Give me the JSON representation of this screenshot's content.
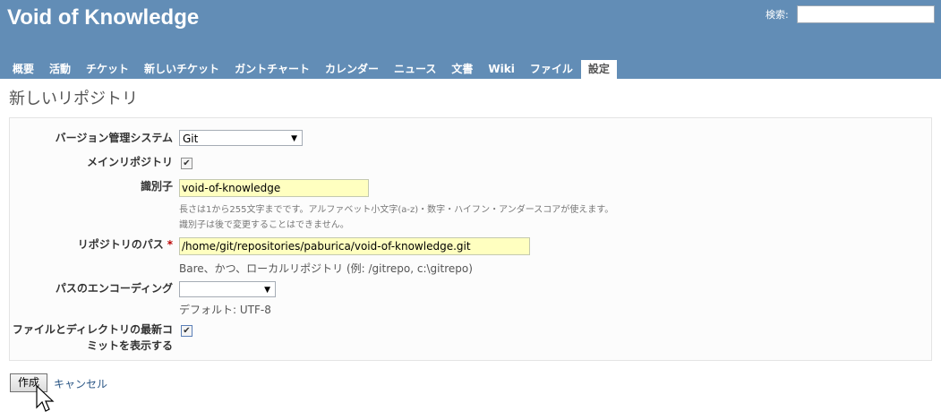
{
  "header": {
    "site_title": "Void of Knowledge",
    "search_label": "検索:",
    "search_value": ""
  },
  "tabs": [
    {
      "label": "概要"
    },
    {
      "label": "活動"
    },
    {
      "label": "チケット"
    },
    {
      "label": "新しいチケット"
    },
    {
      "label": "ガントチャート"
    },
    {
      "label": "カレンダー"
    },
    {
      "label": "ニュース"
    },
    {
      "label": "文書"
    },
    {
      "label": "Wiki"
    },
    {
      "label": "ファイル"
    },
    {
      "label": "設定",
      "selected": true
    }
  ],
  "page_title": "新しいリポジトリ",
  "form": {
    "scm": {
      "label": "バージョン管理システム",
      "value": "Git"
    },
    "main_repo": {
      "label": "メインリポジトリ",
      "checked": true
    },
    "identifier": {
      "label": "識別子",
      "value": "void-of-knowledge",
      "hint1": "長さは1から255文字までです。アルファベット小文字(a-z)・数字・ハイフン・アンダースコアが使えます。",
      "hint2": "識別子は後で変更することはできません。"
    },
    "repo_path": {
      "label": "リポジトリのパス",
      "required_mark": "*",
      "value": "/home/git/repositories/paburica/void-of-knowledge.git",
      "hint": "Bare、かつ、ローカルリポジトリ (例: /gitrepo, c:\\gitrepo)"
    },
    "path_encoding": {
      "label": "パスのエンコーディング",
      "value": "",
      "hint": "デフォルト: UTF-8"
    },
    "report_last_commit": {
      "label_line1": "ファイルとディレクトリの最新コ",
      "label_line2": "ミットを表示する",
      "checked": true
    }
  },
  "actions": {
    "create_label": "作成",
    "cancel_label": "キャンセル"
  },
  "icons": {
    "dropdown": "▼",
    "check": "✔"
  }
}
